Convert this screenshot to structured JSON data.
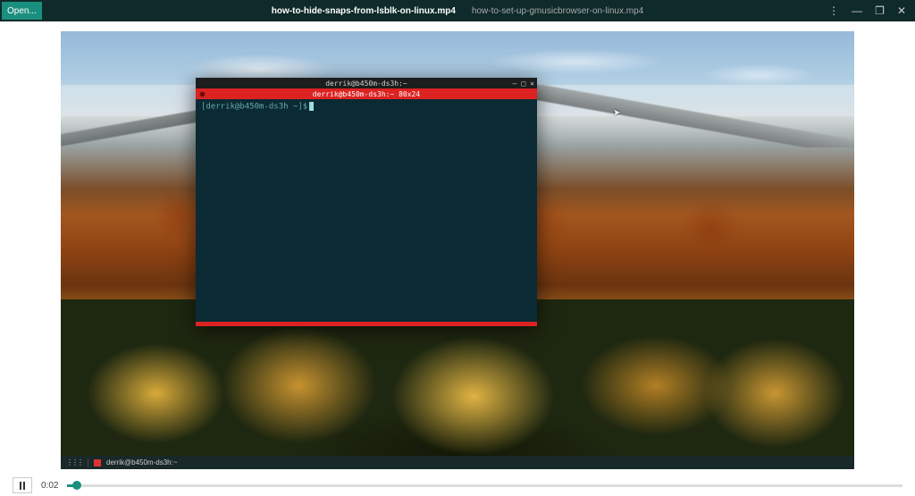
{
  "header": {
    "open_label": "Open...",
    "tabs": [
      {
        "label": "how-to-hide-snaps-from-lsblk-on-linux.mp4",
        "active": true
      },
      {
        "label": "how-to-set-up-gmusicbrowser-on-linux.mp4",
        "active": false
      }
    ],
    "icons": {
      "menu": "⋮",
      "minimize": "—",
      "maximize": "❐",
      "close": "✕"
    }
  },
  "terminal": {
    "title": "derrik@b450m-ds3h:~",
    "tab_label": "derrik@b450m-ds3h:~ 80x24",
    "prompt": "[derrik@b450m-ds3h ~]$",
    "wincontrols": {
      "min": "—",
      "max": "□",
      "close": "✕"
    }
  },
  "desktop_taskbar": {
    "grid_icon": "⋮⋮⋮",
    "app_label": "derrik@b450m-ds3h:~"
  },
  "player": {
    "time": "0:02",
    "progress_pct": "1.1%"
  },
  "colors": {
    "accent": "#1b8f7f",
    "header_bg": "#0e2a2a",
    "terminal_bg": "#0b2a33",
    "terminal_red": "#d22"
  }
}
